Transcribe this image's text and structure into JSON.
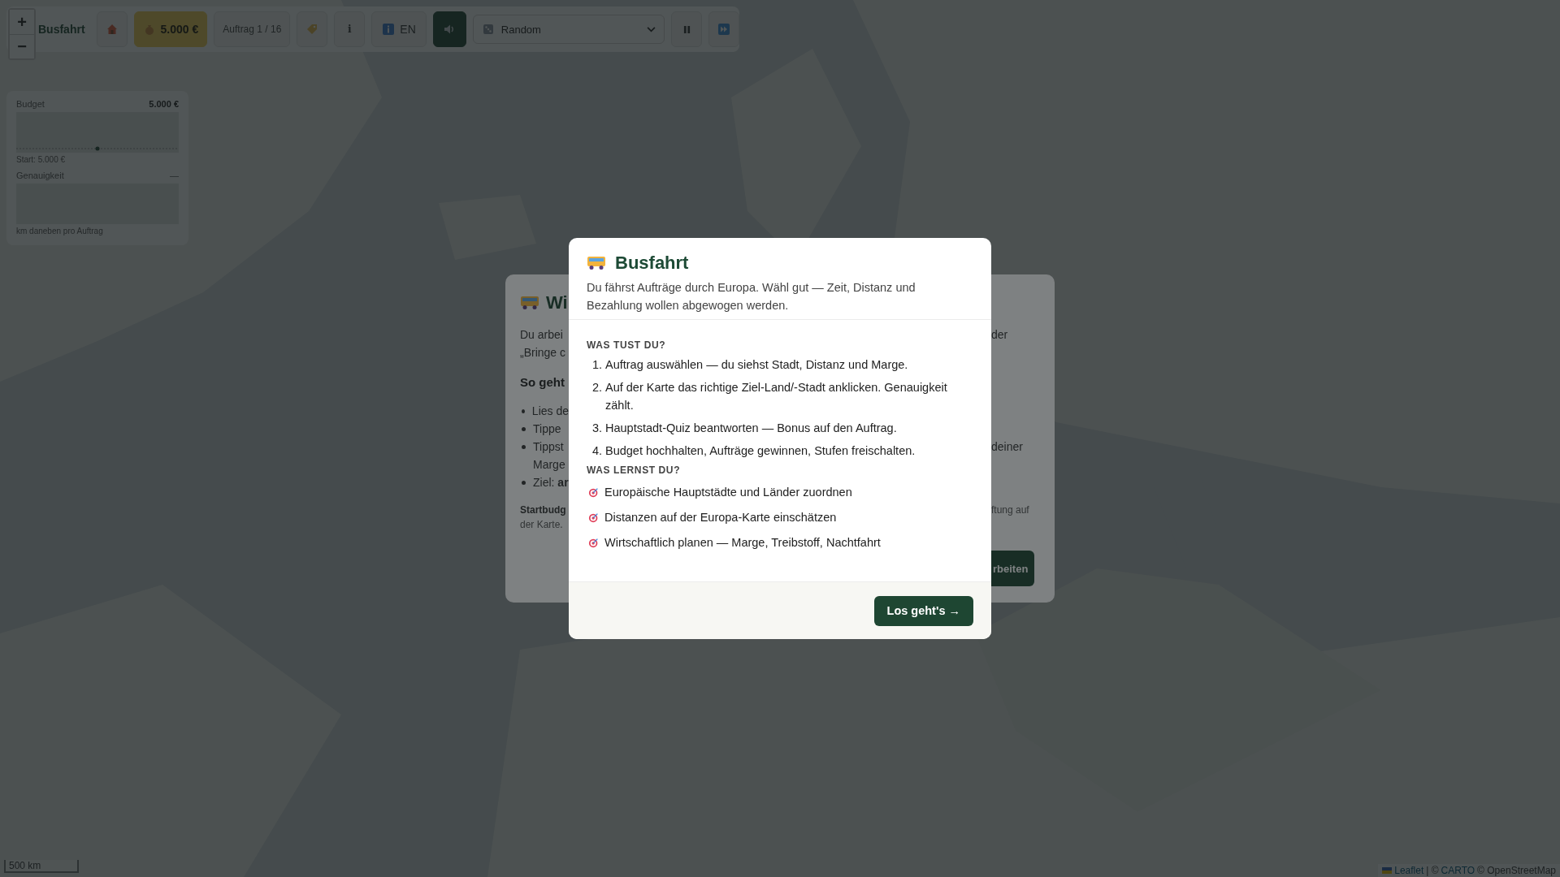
{
  "map": {
    "kind": "picture",
    "scale": "500 km",
    "attribution": {
      "leaflet": "Leaflet",
      "separator": "| ©",
      "carto": "CARTO",
      "osm": "© OpenStreetMap"
    }
  },
  "zoom": {
    "zoom_in": "+",
    "zoom_out": "−"
  },
  "toolbar": {
    "title": "Busfahrt",
    "budget": "5.000 €",
    "order_counter": "Auftrag 1 / 16",
    "info": "i",
    "language": "EN",
    "mode_select": {
      "value": "Random"
    }
  },
  "stats_panel": {
    "budget": {
      "label": "Budget",
      "value": "5.000 €",
      "note": "Start: 5.000 €"
    },
    "accuracy": {
      "label": "Genauigkeit",
      "value": "—",
      "note": "km daneben pro Auftrag"
    }
  },
  "background_dialog": {
    "title": "Wi",
    "intro_left": [
      "Du arbei",
      "„Bringe c"
    ],
    "intro_right": "der",
    "section": "So geht",
    "bullets": [
      {
        "lines": [
          "Lies de"
        ]
      },
      {
        "lines": [
          "Tippe"
        ]
      },
      {
        "lines": [
          "Tippst",
          "Marge"
        ]
      },
      {
        "lines": [
          "Ziel: **ar**"
        ]
      }
    ],
    "bullet_right": "deiner",
    "footnote_left": [
      "Startbudg",
      "der Karte."
    ],
    "footnote_right": "ftung auf",
    "button": "rbeiten"
  },
  "welcome_dialog": {
    "title": "Busfahrt",
    "subtitle": "Du fährst Aufträge durch Europa. Wähl gut — Zeit, Distanz und Bezahlung wollen abgewogen werden.",
    "steps_heading": "WAS TUST DU?",
    "steps": [
      {
        "number": "1.",
        "text": "Auftrag auswählen — du siehst Stadt, Distanz und Marge."
      },
      {
        "number": "2.",
        "text": "Auf der Karte das richtige Ziel-Land/-Stadt anklicken. Genauigkeit zählt."
      },
      {
        "number": "3.",
        "text": "Hauptstadt-Quiz beantworten — Bonus auf den Auftrag."
      },
      {
        "number": "4.",
        "text": "Budget hochhalten, Aufträge gewinnen, Stufen freischalten."
      }
    ],
    "goals_heading": "WAS LERNST DU?",
    "goals": [
      "Europäische Hauptstädte und Länder zuordnen",
      "Distanzen auf der Europa-Karte einschätzen",
      "Wirtschaftlich planen — Marge, Treibstoff, Nachtfahrt"
    ],
    "start_button": "Los geht's →"
  }
}
